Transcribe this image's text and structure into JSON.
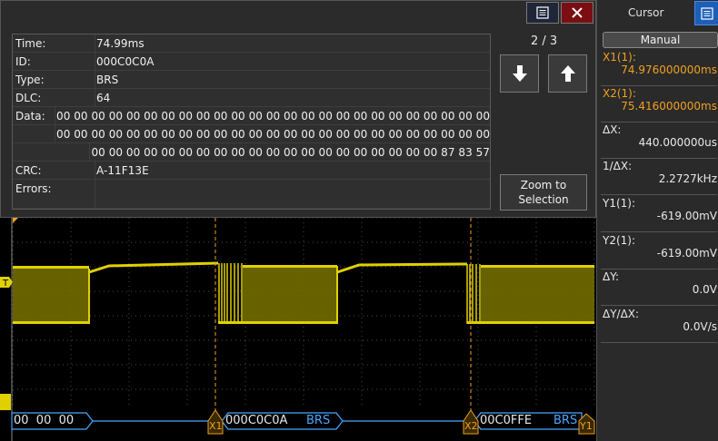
{
  "popup": {
    "counter": "2 / 3",
    "zoom_label": "Zoom to Selection",
    "rows": [
      {
        "key": "Time:",
        "value": "74.99ms"
      },
      {
        "key": "ID:",
        "value": "000C0C0A"
      },
      {
        "key": "Type:",
        "value": "BRS"
      },
      {
        "key": "DLC:",
        "value": "64"
      },
      {
        "key": "Data:",
        "value": "00 00 00 00 00 00 00 00 00 00 00 00 00 00 00 00 00 00 00 00 00 00 00 00 00"
      },
      {
        "key": "",
        "value": "00 00 00 00 00 00 00 00 00 00 00 00 00 00 00 00 00 00 00 00 00 00 00 00 00"
      },
      {
        "key": "",
        "value": "00 00 00 00 00 00 00 00 00 00 00 00 00 00 00 00 00 00 00 00 87 83 57"
      },
      {
        "key": "CRC:",
        "value": "A-11F13E"
      },
      {
        "key": "Errors:",
        "value": ""
      }
    ]
  },
  "panel": {
    "title": "Cursor",
    "mode": "Manual",
    "items": [
      {
        "label": "X1(1):",
        "value": "74.976000000ms",
        "color": "orange"
      },
      {
        "label": "X2(1):",
        "value": "75.416000000ms",
        "color": "orange"
      },
      {
        "label": "ΔX:",
        "value": "440.000000us",
        "color": "white"
      },
      {
        "label": "1/ΔX:",
        "value": "2.2727kHz",
        "color": "white"
      },
      {
        "label": "Y1(1):",
        "value": "-619.00mV",
        "color": "white"
      },
      {
        "label": "Y2(1):",
        "value": "-619.00mV",
        "color": "white"
      },
      {
        "label": "ΔY:",
        "value": "0.0V",
        "color": "white"
      },
      {
        "label": "ΔY/ΔX:",
        "value": "0.0V/s",
        "color": "white"
      }
    ]
  },
  "bus": {
    "seg1": "00  00  00",
    "seg2_id": "000C0C0A",
    "seg2_type": "BRS",
    "seg3_id": "00C0FFE",
    "seg3_type": "BRS"
  },
  "markers": {
    "x1": "X1",
    "x2": "X2",
    "y1": "Y1",
    "trig": "T"
  },
  "colors": {
    "signal": "#e0d000",
    "cursor_x": "#f0a020",
    "bus": "#4aa8ff"
  }
}
